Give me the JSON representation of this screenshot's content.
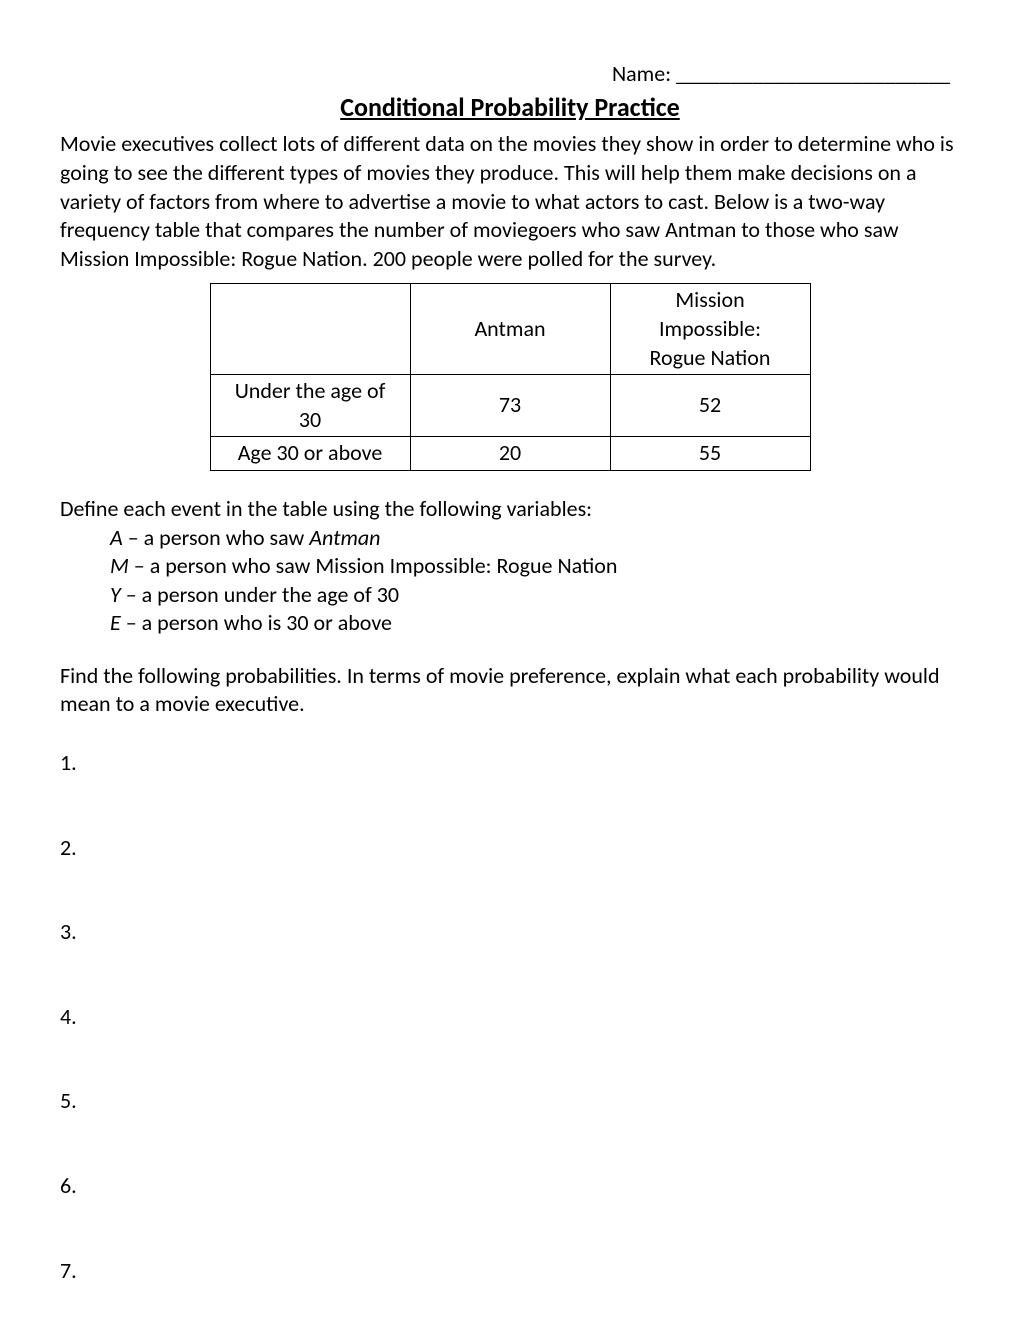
{
  "header": {
    "name_label": "Name: ",
    "name_blank": "_________________________"
  },
  "title": "Conditional Probability Practice",
  "intro_text": "Movie executives collect lots of different data on the movies they show in order to determine who is going to see the different types of movies they produce.  This will help them make decisions on a variety of factors from where to advertise a movie to what actors to cast.  Below is a two-way frequency table that compares the number of moviegoers who saw Antman to those who saw Mission Impossible: Rogue Nation.  200 people were polled for the survey.",
  "table": {
    "col1_header": "Antman",
    "col2_header_line1": "Mission Impossible:",
    "col2_header_line2": "Rogue Nation",
    "rows": [
      {
        "label": "Under the age of 30",
        "antman": "73",
        "mi": "52"
      },
      {
        "label": "Age 30 or above",
        "antman": "20",
        "mi": "55"
      }
    ]
  },
  "define": {
    "heading": "Define each event in the table using the following variables:",
    "items": [
      {
        "var": "A",
        "sep": " – ",
        "desc_prefix": "a person who saw ",
        "desc_italic": "Antman"
      },
      {
        "var": "M",
        "sep": " – ",
        "desc": "a person who saw Mission Impossible: Rogue Nation"
      },
      {
        "var": "Y",
        "sep": " – ",
        "desc": "a person under the age of 30"
      },
      {
        "var": "E",
        "sep": " – ",
        "desc": "a person who is 30 or above"
      }
    ]
  },
  "instruction": "Find the following probabilities.  In terms of movie preference, explain what each probability would mean to a movie executive.",
  "questions": [
    "1.",
    "2.",
    "3.",
    "4.",
    "5.",
    "6.",
    "7."
  ]
}
